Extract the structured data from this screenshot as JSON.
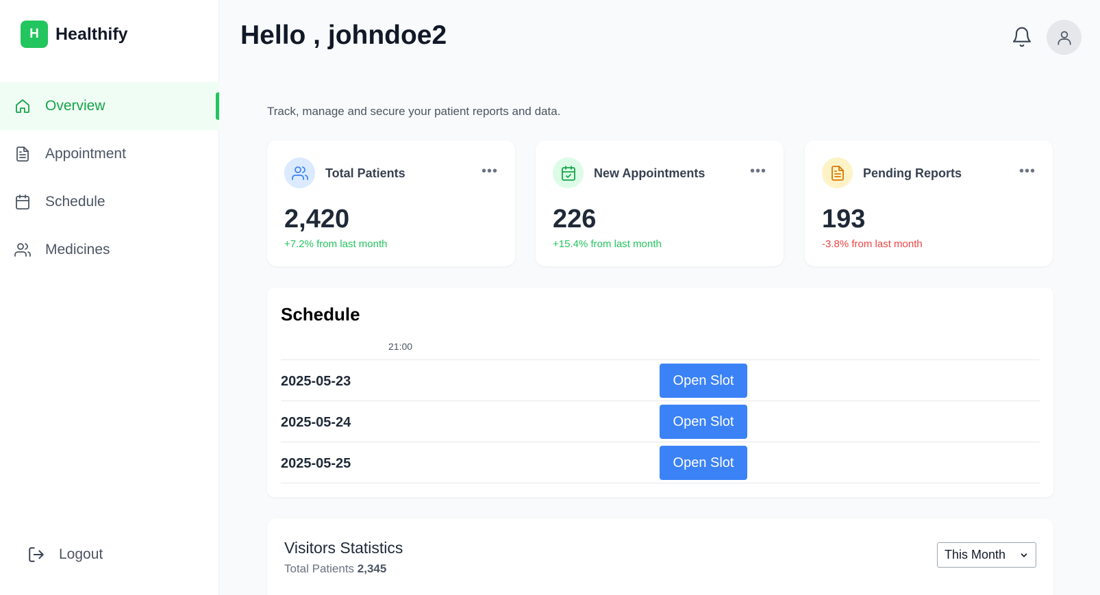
{
  "brand": {
    "logo_letter": "H",
    "name": "Healthify",
    "color": "#22c55e"
  },
  "sidebar": {
    "items": [
      {
        "label": "Overview",
        "icon": "home-icon",
        "active": true
      },
      {
        "label": "Appointment",
        "icon": "document-icon",
        "active": false
      },
      {
        "label": "Schedule",
        "icon": "calendar-icon",
        "active": false
      },
      {
        "label": "Medicines",
        "icon": "users-icon",
        "active": false
      }
    ],
    "logout_label": "Logout"
  },
  "header": {
    "greeting": "Hello , johndoe2"
  },
  "subtitle": "Track, manage and secure your patient reports and data.",
  "stats": [
    {
      "title": "Total Patients",
      "value": "2,420",
      "change": "+7.2% from last month",
      "trend": "up",
      "icon": "users-icon",
      "icon_bg": "#dbeafe",
      "icon_color": "#3b82f6"
    },
    {
      "title": "New Appointments",
      "value": "226",
      "change": "+15.4% from last month",
      "trend": "up",
      "icon": "calendar-check-icon",
      "icon_bg": "#dcfce7",
      "icon_color": "#16a34a"
    },
    {
      "title": "Pending Reports",
      "value": "193",
      "change": "-3.8% from last month",
      "trend": "down",
      "icon": "file-text-icon",
      "icon_bg": "#fef3c7",
      "icon_color": "#d97706"
    }
  ],
  "schedule": {
    "title": "Schedule",
    "time_header": "21:00",
    "rows": [
      {
        "date": "2025-05-23",
        "slot_label": "Open Slot"
      },
      {
        "date": "2025-05-24",
        "slot_label": "Open Slot"
      },
      {
        "date": "2025-05-25",
        "slot_label": "Open Slot"
      }
    ]
  },
  "visitors": {
    "title": "Visitors Statistics",
    "total_label": "Total Patients",
    "total_value": "2,345",
    "period_selected": "This Month"
  },
  "colors": {
    "accent": "#22c55e",
    "primary_button": "#3b82f6",
    "positive": "#22c55e",
    "negative": "#ef4444"
  }
}
